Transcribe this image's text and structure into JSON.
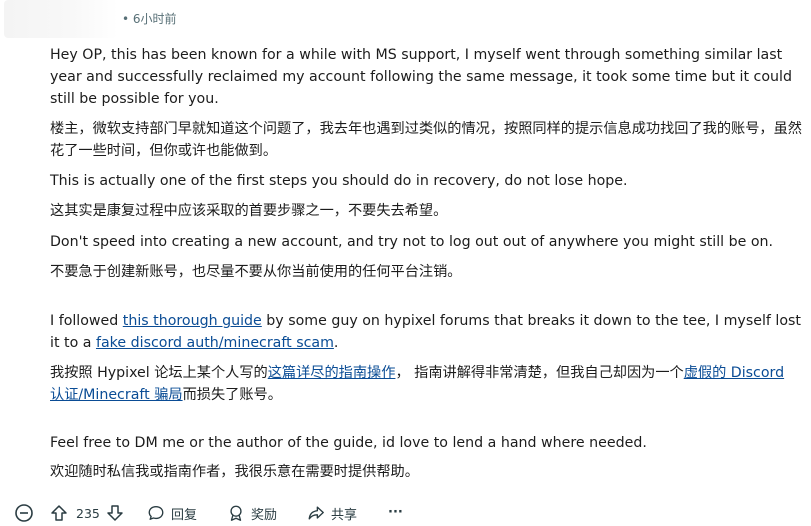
{
  "comment": {
    "time": "• 6小时前",
    "paragraphs": [
      {
        "parts": [
          {
            "t": "Hey OP, this has been known for a while with MS support, I myself went through something similar last year and successfully reclaimed my account following the same message, it took some time but it could still be possible for you."
          }
        ]
      },
      {
        "parts": [
          {
            "t": "楼主，微软支持部门早就知道这个问题了，我去年也遇到过类似的情况，按照同样的提示信息成功找回了我的账号，虽然花了一些时间，但你或许也能做到。"
          }
        ]
      },
      {
        "parts": [
          {
            "t": "This is actually one of the first steps you should do in recovery, do not lose hope."
          }
        ]
      },
      {
        "parts": [
          {
            "t": "这其实是康复过程中应该采取的首要步骤之一，不要失去希望。"
          }
        ]
      },
      {
        "parts": [
          {
            "t": "Don't speed into creating a new account, and try not to log out out of anywhere you might still be on."
          }
        ]
      },
      {
        "parts": [
          {
            "t": "不要急于创建新账号，也尽量不要从你当前使用的任何平台注销。"
          }
        ]
      },
      {
        "parts": [
          {
            "t": "I followed "
          },
          {
            "t": "this thorough guide",
            "link": true
          },
          {
            "t": " by some guy on hypixel forums that breaks it down to the tee, I myself lost it to a "
          },
          {
            "t": "fake discord auth/minecraft scam",
            "link": true
          },
          {
            "t": "."
          }
        ]
      },
      {
        "parts": [
          {
            "t": "我按照 Hypixel 论坛上某个人写的"
          },
          {
            "t": "这篇详尽的指南操作",
            "link": true
          },
          {
            "t": "， 指南讲解得非常清楚，但我自己却因为一个"
          },
          {
            "t": "虚假的 Discord 认证/Minecraft 骗局",
            "link": true
          },
          {
            "t": "而损失了账号。"
          }
        ]
      },
      {
        "parts": [
          {
            "t": "Feel free to DM me or the author of the guide, id love to lend a hand where needed."
          }
        ]
      },
      {
        "parts": [
          {
            "t": "欢迎随时私信我或指南作者，我很乐意在需要时提供帮助。"
          }
        ]
      }
    ]
  },
  "actions": {
    "vote_count": "235",
    "reply_label": "回复",
    "award_label": "奖励",
    "share_label": "共享",
    "more_label": "···"
  },
  "icons": [
    "collapse-icon",
    "upvote-icon",
    "downvote-icon",
    "reply-icon",
    "award-icon",
    "share-icon",
    "more-icon"
  ],
  "colors": {
    "link": "#0a4c95",
    "meta": "#576f76",
    "text": "#1c1c1c"
  }
}
